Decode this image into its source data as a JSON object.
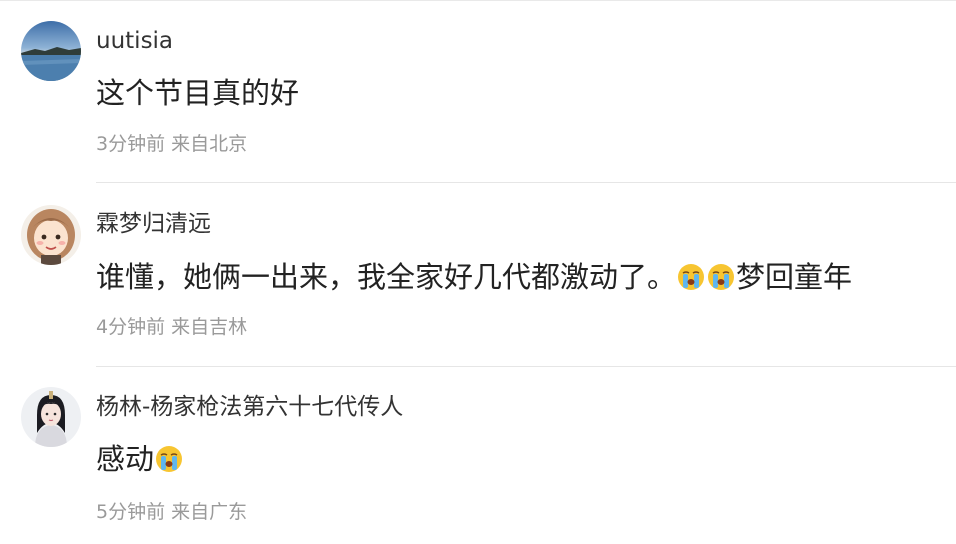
{
  "comments": [
    {
      "username": "uutisia",
      "content_text": "这个节目真的好",
      "time": "3分钟前",
      "location": "来自北京"
    },
    {
      "username": "霖梦归清远",
      "content_text": "谁懂，她俩一出来，我全家好几代都激动了。",
      "content_tail": "梦回童年",
      "emojis": [
        "crying-emoji",
        "crying-emoji"
      ],
      "time": "4分钟前",
      "location": "来自吉林"
    },
    {
      "username": "杨林-杨家枪法第六十七代传人",
      "content_text": "感动",
      "emojis": [
        "crying-emoji"
      ],
      "time": "5分钟前",
      "location": "来自广东"
    }
  ]
}
